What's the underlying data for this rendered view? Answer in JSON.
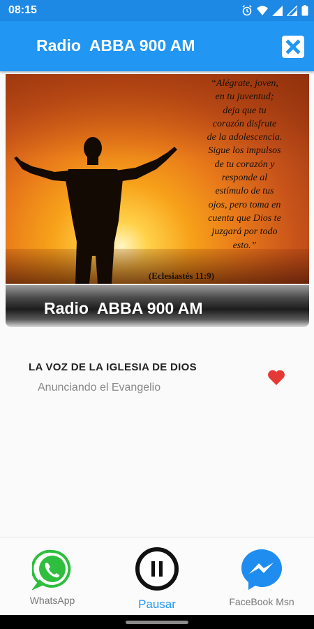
{
  "status_bar": {
    "time": "08:15",
    "icons": [
      "alarm-icon",
      "wifi-icon",
      "signal-icon",
      "battery-icon"
    ]
  },
  "app_bar": {
    "title": "Radio  ABBA 900 AM",
    "close_icon": "close-icon"
  },
  "banner": {
    "verse_lines": [
      "“Alégrate, joven,",
      "en tu juventud;",
      "deja que tu",
      "corazón disfrute",
      "de la adolescencia.",
      "Sigue los impulsos",
      "de tu corazón y",
      "responde al",
      "estímulo de tus",
      "ojos, pero toma en",
      "cuenta que Dios te",
      "juzgará por todo",
      "esto.”"
    ],
    "reference": "(Eclesiastés 11:9)"
  },
  "station_bar": {
    "name": "Radio  ABBA 900 AM"
  },
  "program": {
    "title": "LA VOZ DE LA IGLESIA DE DIOS",
    "subtitle": "Anunciando el Evangelio",
    "favorite_icon": "heart-icon"
  },
  "actions": {
    "whatsapp_label": "WhatsApp",
    "pause_label": "Pausar",
    "messenger_label": "FaceBook Msn"
  },
  "colors": {
    "primary": "#2196f3",
    "status_bar": "#1e88e5",
    "heart": "#e53935",
    "whatsapp": "#2fbe3e",
    "messenger": "#1f8cf0"
  }
}
